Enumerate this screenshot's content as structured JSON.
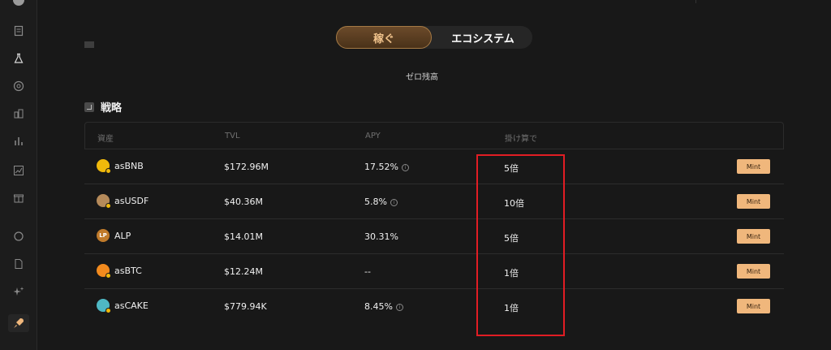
{
  "sidebar": {
    "icons": [
      "logo-icon",
      "document-icon",
      "flask-icon",
      "coin-icon",
      "building-icon",
      "bar-chart-icon",
      "line-chart-icon",
      "gift-icon",
      "chat-icon",
      "file-icon",
      "sparkle-icon",
      "rocket-icon"
    ]
  },
  "tabs": {
    "earn_label": "稼ぐ",
    "ecosystem_label": "エコシステム"
  },
  "assets_section": {
    "zero_balance": "ゼロ残高"
  },
  "strategy": {
    "title": "戦略",
    "headers": [
      "資産",
      "TVL",
      "APY",
      "掛け算で"
    ],
    "rows": [
      {
        "asset": "asBNB",
        "tvl": "$172.96M",
        "apy": "17.52%",
        "apy_info": true,
        "multiplier": "5倍",
        "action": "Mint",
        "icon_color": "#f0b90b"
      },
      {
        "asset": "asUSDF",
        "tvl": "$40.36M",
        "apy": "5.8%",
        "apy_info": true,
        "multiplier": "10倍",
        "action": "Mint",
        "icon_color": "#b58a5a"
      },
      {
        "asset": "ALP",
        "tvl": "$14.01M",
        "apy": "30.31%",
        "apy_info": false,
        "multiplier": "5倍",
        "action": "Mint",
        "icon_color": "#c07a2a",
        "icon_text": "LP"
      },
      {
        "asset": "asBTC",
        "tvl": "$12.24M",
        "apy": "--",
        "apy_info": false,
        "multiplier": "1倍",
        "action": "Mint",
        "icon_color": "#f28a1e"
      },
      {
        "asset": "asCAKE",
        "tvl": "$779.94K",
        "apy": "8.45%",
        "apy_info": true,
        "multiplier": "1倍",
        "action": "Mint",
        "icon_color": "#4fb8c4"
      }
    ]
  },
  "colors": {
    "accent": "#f0b77c",
    "highlight_box": "#e11d24",
    "background": "#181818"
  }
}
